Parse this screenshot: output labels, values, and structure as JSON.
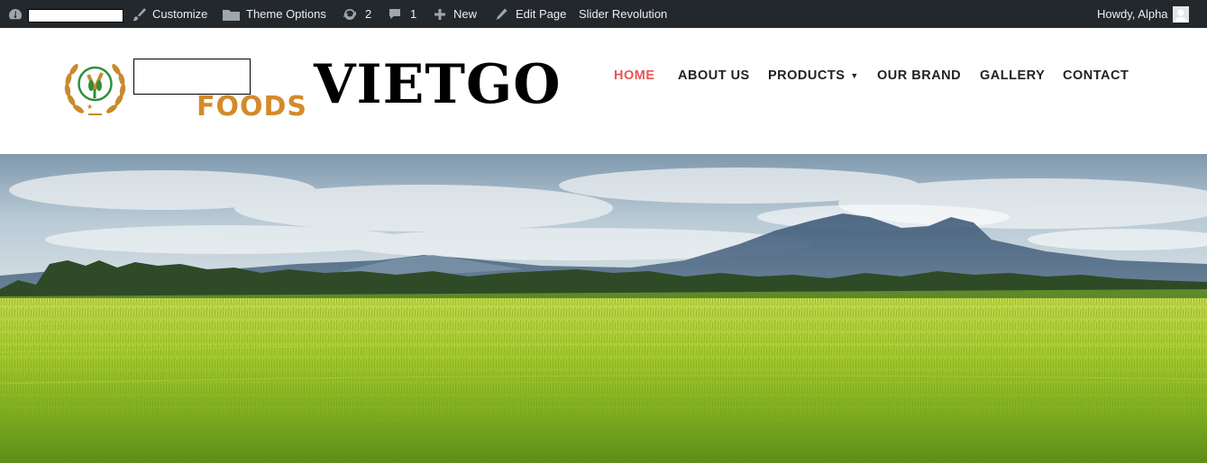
{
  "admin_bar": {
    "customize": "Customize",
    "theme_options": "Theme Options",
    "updates_count": "2",
    "comments_count": "1",
    "new": "New",
    "edit_page": "Edit Page",
    "slider_revolution": "Slider Revolution",
    "greeting": "Howdy, Alpha"
  },
  "header": {
    "logo_sub": "FOODS",
    "brand": "VIETGO"
  },
  "nav": {
    "home": "HOME",
    "about": "ABOUT US",
    "products": "PRODUCTS",
    "brand": "OUR BRAND",
    "gallery": "GALLERY",
    "contact": "CONTACT"
  },
  "colors": {
    "admin_bg": "#23282d",
    "nav_active": "#e85556",
    "logo_gold": "#d48a2a"
  },
  "icons": [
    "dashboard-icon",
    "brush-icon",
    "folder-icon",
    "refresh-icon",
    "comment-icon",
    "plus-icon",
    "pencil-icon",
    "avatar-icon",
    "caret-down-icon"
  ]
}
